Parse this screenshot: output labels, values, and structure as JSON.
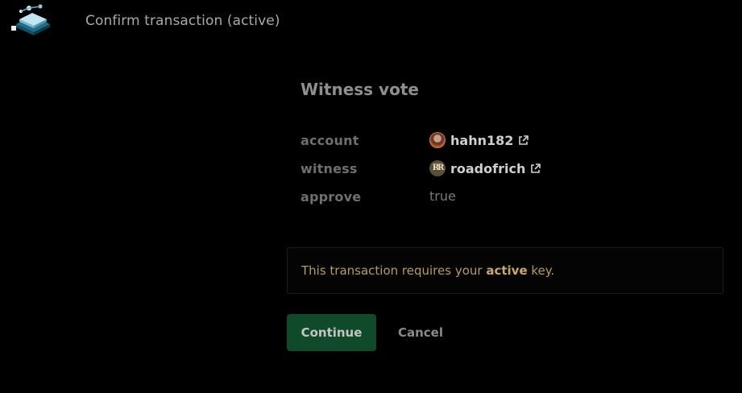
{
  "header": {
    "logo_icon": "hive-keychain-logo-icon",
    "title": "Confirm transaction (active)"
  },
  "operation": {
    "title": "Witness vote",
    "params": [
      {
        "label": "account",
        "value": "hahn182",
        "type": "account",
        "avatar_icon": "user-avatar-icon",
        "link_icon": "external-link-icon"
      },
      {
        "label": "witness",
        "value": "roadofrich",
        "type": "account",
        "avatar_icon": "user-avatar-icon",
        "avatar_text": "RR",
        "link_icon": "external-link-icon"
      },
      {
        "label": "approve",
        "value": "true",
        "type": "boolean"
      }
    ]
  },
  "notice": {
    "prefix": "This transaction requires your ",
    "key": "active",
    "suffix": " key."
  },
  "actions": {
    "continue_label": "Continue",
    "cancel_label": "Cancel"
  },
  "colors": {
    "background": "#000000",
    "primary_button": "#0f4a2b",
    "notice_text": "#b99b5c"
  }
}
